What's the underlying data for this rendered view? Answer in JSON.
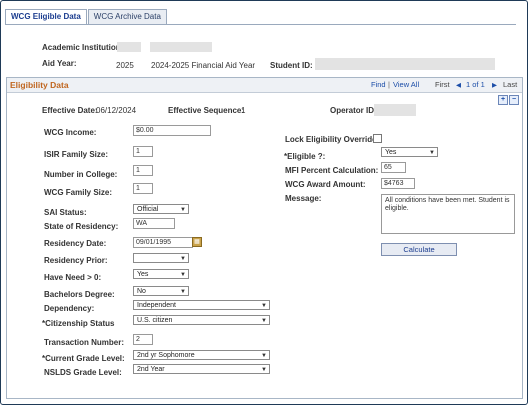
{
  "tabs": [
    "WCG Eligible Data",
    "WCG Archive Data"
  ],
  "header": {
    "institution_label": "Academic Institution:",
    "aid_year_label": "Aid Year:",
    "aid_year": "2025",
    "aid_year_desc": "2024-2025 Financial Aid Year",
    "student_id_label": "Student ID:"
  },
  "panel": {
    "title": "Eligibility Data",
    "find": "Find",
    "sep": "|",
    "view_all": "View All",
    "first": "First",
    "prev": "◀",
    "range": "1 of 1",
    "next": "▶",
    "last": "Last"
  },
  "meta": {
    "effective_date_label": "Effective Date:",
    "effective_date": "06/12/2024",
    "effective_seq_label": "Effective Sequence:",
    "effective_seq": "1",
    "operator_label": "Operator ID:"
  },
  "left": {
    "wcg_income_label": "WCG Income:",
    "wcg_income": "$0.00",
    "isir_family_label": "ISIR Family Size:",
    "isir_family": "1",
    "number_college_label": "Number in College:",
    "number_college": "1",
    "wcg_family_label": "WCG Family Size:",
    "wcg_family": "1",
    "sai_status_label": "SAI Status:",
    "sai_status": "Official",
    "state_label": "State of Residency:",
    "state": "WA",
    "residency_date_label": "Residency Date:",
    "residency_date": "09/01/1995",
    "residency_prior_label": "Residency Prior:",
    "residency_prior": "",
    "have_need_label": "Have Need > 0:",
    "have_need": "Yes",
    "bachelors_label": "Bachelors Degree:",
    "bachelors": "No",
    "dependency_label": "Dependency:",
    "dependency": "Independent",
    "citizenship_label": "*Citizenship Status",
    "citizenship": "U.S. citizen",
    "transaction_label": "Transaction Number:",
    "transaction": "2",
    "grade_label": "*Current Grade Level:",
    "grade": "2nd yr Sophomore",
    "nslds_label": "NSLDS Grade Level:",
    "nslds": "2nd Year"
  },
  "right": {
    "lock_label": "Lock Eligibility Override:",
    "eligible_label": "*Eligible ?:",
    "eligible": "Yes",
    "mfi_label": "MFI Percent Calculation:",
    "mfi": "65",
    "award_label": "WCG Award Amount:",
    "award": "$4763",
    "message_label": "Message:",
    "message": "All conditions have been met.  Student is eligible.",
    "calculate": "Calculate"
  }
}
